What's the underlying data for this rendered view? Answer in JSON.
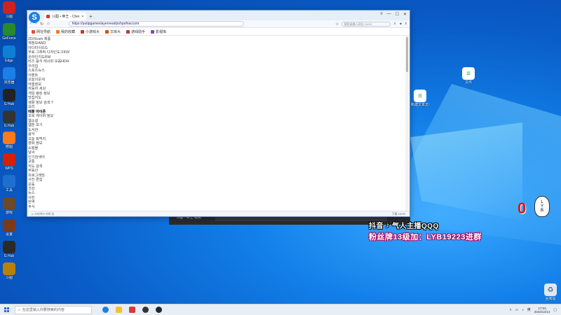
{
  "desktop": {
    "icons": [
      {
        "label": "斗图",
        "color": "#d21f1f"
      },
      {
        "label": "GeForce",
        "color": "#2a8a2a"
      },
      {
        "label": "Edge",
        "color": "#0f7fd6"
      },
      {
        "label": "浏览器",
        "color": "#1b7fe8"
      },
      {
        "label": "G Hub",
        "color": "#222222"
      },
      {
        "label": "G Hub",
        "color": "#333333"
      },
      {
        "label": "修图",
        "color": "#ff7a1a"
      },
      {
        "label": "WPS",
        "color": "#d81e06"
      },
      {
        "label": "工具",
        "color": "#1f6fd0"
      },
      {
        "label": "游戏",
        "color": "#6b4a2a"
      },
      {
        "label": "设置",
        "color": "#7b3a1a"
      },
      {
        "label": "G Hub",
        "color": "#2a2a2a"
      },
      {
        "label": "斗图",
        "color": "#b8820a"
      }
    ],
    "file_icon_1": "文件",
    "file_icon_2": "新建文本文档",
    "recycle_bin": "回收站"
  },
  "browser": {
    "tab_title": "斗图 • 帝王 - Chem",
    "address": "https://putipgameslayerneat/pohpofnaccom",
    "search_placeholder": "搜索或输入网址 Ctrl+K",
    "bookmarks": [
      {
        "label": "网址导航",
        "color": "#e74c3c"
      },
      {
        "label": "我的收藏",
        "color": "#e67e22"
      },
      {
        "label": "小游戏大",
        "color": "#c0392b"
      },
      {
        "label": "文库大",
        "color": "#d35400"
      },
      {
        "label": "游戏助手",
        "color": "#c0392b"
      },
      {
        "label": "影视库",
        "color": "#8e44ad"
      }
    ],
    "lines": [
      {
        "text": "2D/Scam 제품",
        "bold": false
      },
      {
        "text": "재정보AND",
        "bold": false
      },
      {
        "text": "아다타이뜨G",
        "bold": false
      },
      {
        "text": "무료 그래픽 디자인도구KW",
        "bold": false
      },
      {
        "text": "온라인지도RW",
        "bold": false
      },
      {
        "text": "비즈 음식 레시피 모음HDH",
        "bold": false
      },
      {
        "text": "우리집",
        "bold": false
      },
      {
        "text": "스포츠뉴스",
        "bold": false
      },
      {
        "text": "이벤트",
        "bold": false
      },
      {
        "text": "오늘의운세",
        "bold": false
      },
      {
        "text": "여행정보",
        "bold": false
      },
      {
        "text": "자동차 세상",
        "bold": false
      },
      {
        "text": "게임 랭킹 정보",
        "bold": false
      },
      {
        "text": "맛집지도",
        "bold": false
      },
      {
        "text": "생활 정보 검색 T",
        "bold": false
      },
      {
        "text": "요리",
        "bold": false
      },
      {
        "text": "애플 아이폰",
        "bold": true
      },
      {
        "text": "프로 게이머 정보",
        "bold": false
      },
      {
        "text": "웹소설",
        "bold": false
      },
      {
        "text": "웹툰 보기",
        "bold": false
      },
      {
        "text": "도서관",
        "bold": false
      },
      {
        "text": "음악",
        "bold": false
      },
      {
        "text": "오늘 뭐먹지",
        "bold": false
      },
      {
        "text": "영화 정보",
        "bold": false
      },
      {
        "text": "쇼핑몰",
        "bold": false
      },
      {
        "text": "날씨",
        "bold": false
      },
      {
        "text": "인기검색어",
        "bold": false
      },
      {
        "text": "교통",
        "bold": false
      },
      {
        "text": "지도 검색",
        "bold": false
      },
      {
        "text": "부동산",
        "bold": false
      },
      {
        "text": "프로그래밍",
        "bold": false
      },
      {
        "text": "사진 편집",
        "bold": false
      },
      {
        "text": "운동",
        "bold": false
      },
      {
        "text": "건강",
        "bold": false
      },
      {
        "text": "뉴스",
        "bold": false
      },
      {
        "text": "사전",
        "bold": false
      },
      {
        "text": "번역",
        "bold": false
      },
      {
        "text": "주식",
        "bold": false
      }
    ],
    "status_left": "▷ 스타벅스 커피 팁",
    "status_right": "下载  100%"
  },
  "darkwin": {
    "text": "斗图 · 帝王 视频"
  },
  "overlay": {
    "streamer": "抖音",
    "streamer_name": "气人主播QQQ",
    "fans": "粉丝牌13级加：LYB19223进群",
    "counter": "0",
    "bubble_top": "L",
    "bubble_mid": "Y",
    "bubble_bot": "B"
  },
  "taskbar": {
    "search_placeholder": "在这里输入你要搜索的内容",
    "time": "17:03",
    "date": "2023/12/14"
  }
}
